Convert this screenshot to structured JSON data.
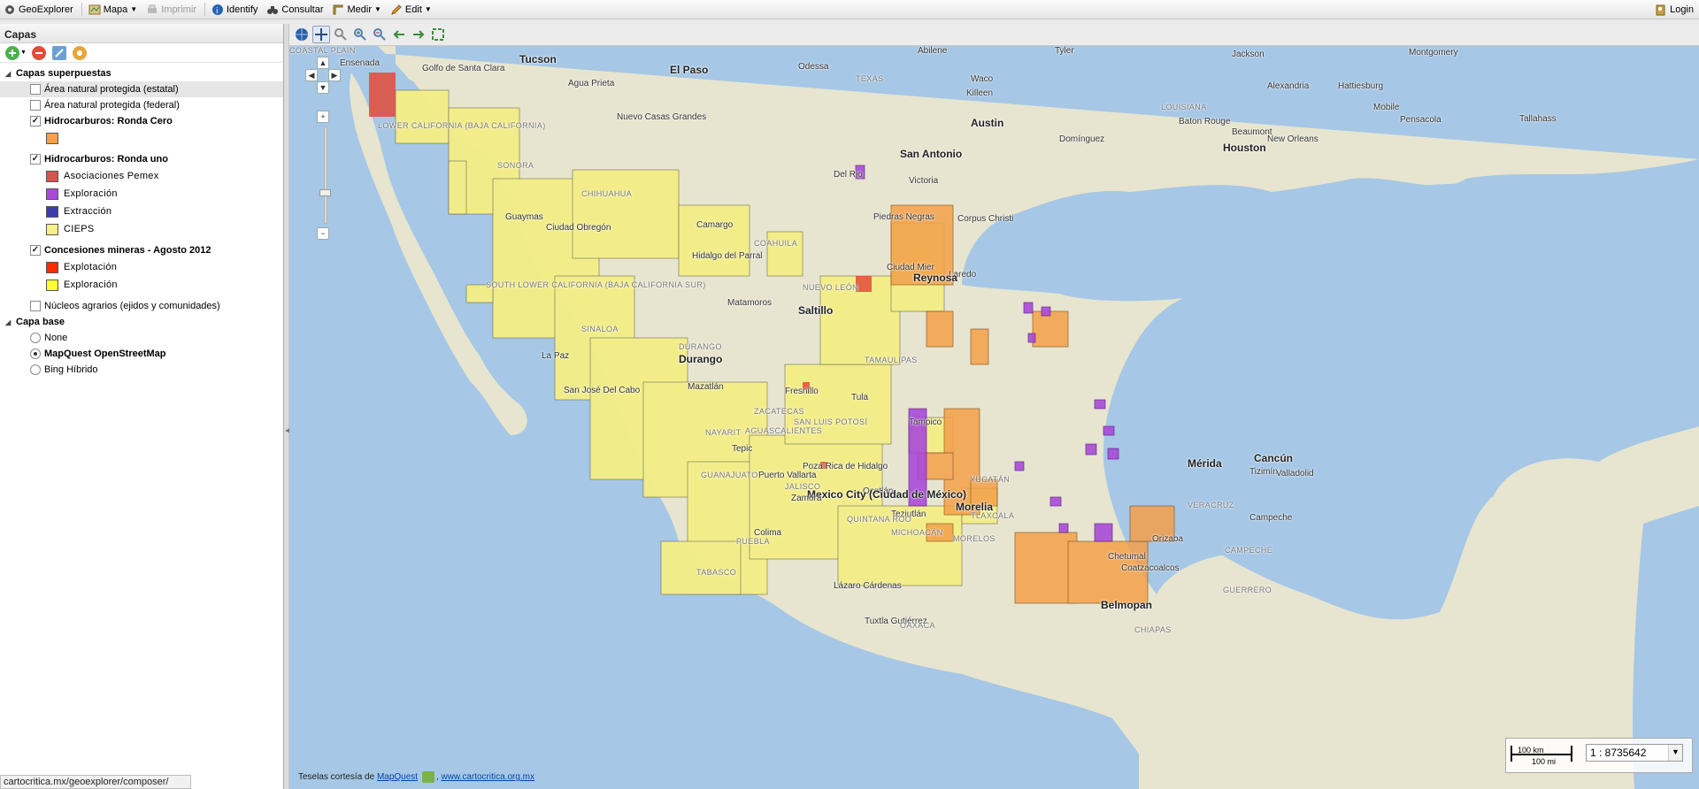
{
  "toolbar": {
    "app_name": "GeoExplorer",
    "mapa": "Mapa",
    "imprimir": "Imprimir",
    "identify": "Identify",
    "consultar": "Consultar",
    "medir": "Medir",
    "edit": "Edit",
    "login": "Login"
  },
  "panel": {
    "title": "Capas",
    "overlays_group": "Capas superpuestas",
    "layers": [
      {
        "label": "Área natural protegida (estatal)",
        "checked": false
      },
      {
        "label": "Área natural protegida (federal)",
        "checked": false
      },
      {
        "label": "Hidrocarburos: Ronda Cero",
        "checked": true
      },
      {
        "label": "Hidrocarburos: Ronda uno",
        "checked": true
      },
      {
        "label": "Concesiones mineras - Agosto 2012",
        "checked": true
      },
      {
        "label": "Núcleos agrarios (ejidos y comunidades)",
        "checked": false
      }
    ],
    "ronda_cero_legend": [
      {
        "color": "#f4a04a"
      }
    ],
    "ronda_uno_legend": [
      {
        "label": "Asociaciones Pemex",
        "color": "#d9534f"
      },
      {
        "label": "Exploración",
        "color": "#a94ad9"
      },
      {
        "label": "Extracción",
        "color": "#3d3da8"
      },
      {
        "label": "CIEPS",
        "color": "#f7f08a"
      }
    ],
    "mineras_legend": [
      {
        "label": "Explotación",
        "color": "#ff2a00"
      },
      {
        "label": "Exploración",
        "color": "#ffff33"
      }
    ],
    "base_group": "Capa base",
    "base_layers": [
      {
        "label": "None",
        "selected": false
      },
      {
        "label": "MapQuest OpenStreetMap",
        "selected": true
      },
      {
        "label": "Bing Híbrido",
        "selected": false
      }
    ]
  },
  "status_url": "cartocritica.mx/geoexplorer/composer/",
  "map": {
    "attribution_prefix": "Teselas cortesía de",
    "attribution_link1": "MapQuest",
    "attribution_link2": "www.cartocritica.org.mx",
    "scale_km": "100 km",
    "scale_mi": "100 mi",
    "scale_value": "1 : 8735642",
    "places": [
      {
        "name": "Tucson",
        "cls": "big"
      },
      {
        "name": "El Paso",
        "cls": "big"
      },
      {
        "name": "Odessa",
        "cls": ""
      },
      {
        "name": "Abilene",
        "cls": ""
      },
      {
        "name": "Tyler",
        "cls": ""
      },
      {
        "name": "Jackson",
        "cls": ""
      },
      {
        "name": "Montgomery",
        "cls": ""
      },
      {
        "name": "TEXAS",
        "cls": "region"
      },
      {
        "name": "Waco",
        "cls": ""
      },
      {
        "name": "Alexandria",
        "cls": ""
      },
      {
        "name": "Hattiesburg",
        "cls": ""
      },
      {
        "name": "Killeen",
        "cls": ""
      },
      {
        "name": "LOUISIANA",
        "cls": "region"
      },
      {
        "name": "Austin",
        "cls": "big"
      },
      {
        "name": "Baton Rouge",
        "cls": ""
      },
      {
        "name": "Mobile",
        "cls": ""
      },
      {
        "name": "Tallahass",
        "cls": ""
      },
      {
        "name": "Pensacola",
        "cls": ""
      },
      {
        "name": "Beaumont",
        "cls": ""
      },
      {
        "name": "Houston",
        "cls": "big"
      },
      {
        "name": "New Orleans",
        "cls": ""
      },
      {
        "name": "San Antonio",
        "cls": "big"
      },
      {
        "name": "Del Rio",
        "cls": ""
      },
      {
        "name": "Victoria",
        "cls": ""
      },
      {
        "name": "Piedras Negras",
        "cls": ""
      },
      {
        "name": "Corpus Christi",
        "cls": ""
      },
      {
        "name": "Laredo",
        "cls": ""
      },
      {
        "name": "Ensenada",
        "cls": ""
      },
      {
        "name": "Golfo de Santa Clara",
        "cls": ""
      },
      {
        "name": "Agua Prieta",
        "cls": ""
      },
      {
        "name": "Nuevo Casas Grandes",
        "cls": ""
      },
      {
        "name": "LOWER CALIFORNIA (BAJA CALIFORNIA)",
        "cls": "region"
      },
      {
        "name": "SONORA",
        "cls": "region"
      },
      {
        "name": "CHIHUAHUA",
        "cls": "region"
      },
      {
        "name": "Guaymas",
        "cls": ""
      },
      {
        "name": "Ciudad Obregón",
        "cls": ""
      },
      {
        "name": "Camargo",
        "cls": ""
      },
      {
        "name": "Hidalgo del Parral",
        "cls": ""
      },
      {
        "name": "COAHUILA",
        "cls": "region"
      },
      {
        "name": "Ciudad Mier",
        "cls": ""
      },
      {
        "name": "Reynosa",
        "cls": "big"
      },
      {
        "name": "NUEVO LEÓN",
        "cls": "region"
      },
      {
        "name": "SOUTH LOWER CALIFORNIA (BAJA CALIFORNIA SUR)",
        "cls": "region"
      },
      {
        "name": "Matamoros",
        "cls": ""
      },
      {
        "name": "Saltillo",
        "cls": "big"
      },
      {
        "name": "SINALOA",
        "cls": "region"
      },
      {
        "name": "DURANGO",
        "cls": "region"
      },
      {
        "name": "La Paz",
        "cls": ""
      },
      {
        "name": "Durango",
        "cls": "big"
      },
      {
        "name": "TAMAULIPAS",
        "cls": "region"
      },
      {
        "name": "San José Del Cabo",
        "cls": ""
      },
      {
        "name": "Mazatlán",
        "cls": ""
      },
      {
        "name": "Fresnillo",
        "cls": ""
      },
      {
        "name": "ZACATECAS",
        "cls": "region"
      },
      {
        "name": "Tula",
        "cls": ""
      },
      {
        "name": "SAN LUIS POTOSÍ",
        "cls": "region"
      },
      {
        "name": "Tampico",
        "cls": ""
      },
      {
        "name": "NAYARIT",
        "cls": "region"
      },
      {
        "name": "AGUASCALIENTES",
        "cls": "region"
      },
      {
        "name": "Tepic",
        "cls": ""
      },
      {
        "name": "Mérida",
        "cls": "big"
      },
      {
        "name": "Cancún",
        "cls": "big"
      },
      {
        "name": "Tizimín",
        "cls": ""
      },
      {
        "name": "Valladolid",
        "cls": ""
      },
      {
        "name": "YUCATÁN",
        "cls": "region"
      },
      {
        "name": "Poza Rica de Hidalgo",
        "cls": ""
      },
      {
        "name": "GUANAJUATO",
        "cls": "region"
      },
      {
        "name": "Puerto Vallarta",
        "cls": ""
      },
      {
        "name": "JALISCO",
        "cls": "region"
      },
      {
        "name": "Ocotlán",
        "cls": ""
      },
      {
        "name": "Mexico City (Ciudad de México)",
        "cls": "big"
      },
      {
        "name": "Zamora",
        "cls": ""
      },
      {
        "name": "Morelia",
        "cls": "big"
      },
      {
        "name": "Teziutlán",
        "cls": ""
      },
      {
        "name": "TLAXCALA",
        "cls": "region"
      },
      {
        "name": "VERACRUZ",
        "cls": "region"
      },
      {
        "name": "Campeche",
        "cls": ""
      },
      {
        "name": "QUINTANA ROO",
        "cls": "region"
      },
      {
        "name": "PUEBLA",
        "cls": "region"
      },
      {
        "name": "Colima",
        "cls": ""
      },
      {
        "name": "MICHOACÁN",
        "cls": "region"
      },
      {
        "name": "MORELOS",
        "cls": "region"
      },
      {
        "name": "Orizaba",
        "cls": ""
      },
      {
        "name": "CAMPECHE",
        "cls": "region"
      },
      {
        "name": "Chetumal",
        "cls": ""
      },
      {
        "name": "Coatzacoalcos",
        "cls": ""
      },
      {
        "name": "TABASCO",
        "cls": "region"
      },
      {
        "name": "Lázaro Cárdenas",
        "cls": ""
      },
      {
        "name": "GUERRERO",
        "cls": "region"
      },
      {
        "name": "Belmopan",
        "cls": "big"
      },
      {
        "name": "Tuxtla Gutiérrez",
        "cls": ""
      },
      {
        "name": "OAXACA",
        "cls": "region"
      },
      {
        "name": "CHIAPAS",
        "cls": "region"
      },
      {
        "name": "Domínguez",
        "cls": ""
      },
      {
        "name": "COASTAL PLAIN",
        "cls": "region"
      }
    ]
  }
}
